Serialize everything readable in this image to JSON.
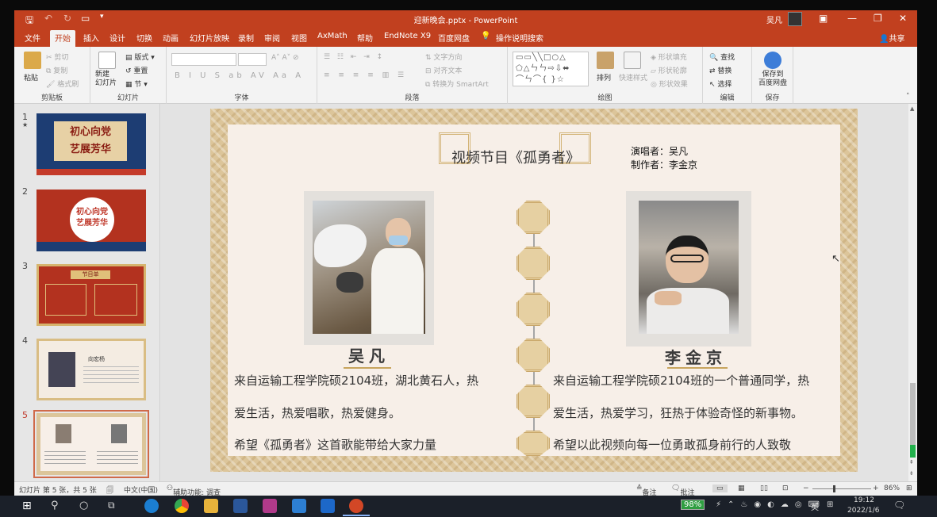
{
  "window": {
    "title": "迎新晚会.pptx - PowerPoint",
    "user": "吴凡"
  },
  "tabs": [
    "文件",
    "开始",
    "插入",
    "设计",
    "切换",
    "动画",
    "幻灯片放映",
    "录制",
    "审阅",
    "视图",
    "AxMath",
    "帮助",
    "EndNote X9",
    "百度网盘",
    "操作说明搜索",
    "共享"
  ],
  "ribbon": {
    "clipboard": {
      "label": "剪贴板",
      "paste": "粘贴",
      "cut": "剪切",
      "copy": "复制",
      "painter": "格式刷"
    },
    "slides": {
      "label": "幻灯片",
      "new_slide": "新建\n幻灯片",
      "layout": "版式",
      "reset": "重置",
      "section": "节"
    },
    "font": {
      "label": "字体"
    },
    "paragraph": {
      "label": "段落",
      "text_direction": "文字方向",
      "align_text": "对齐文本",
      "smartart": "转换为 SmartArt"
    },
    "drawing": {
      "label": "绘图",
      "arrange": "排列",
      "quick_styles": "快速样式",
      "fill": "形状填充",
      "outline": "形状轮廓",
      "effects": "形状效果"
    },
    "editing": {
      "label": "编辑",
      "find": "查找",
      "replace": "替换",
      "select": "选择"
    },
    "save": {
      "label": "保存",
      "save_baidu": "保存到\n百度网盘"
    }
  },
  "thumbnails": [
    {
      "num": "1",
      "star": "★",
      "text": "初心向党\n艺展芳华"
    },
    {
      "num": "2",
      "text": "初心向党\n艺展芳华"
    },
    {
      "num": "3",
      "text": "节目单"
    },
    {
      "num": "4",
      "text": "向宏杨"
    },
    {
      "num": "5",
      "text": ""
    }
  ],
  "slide": {
    "title": "视频节目《孤勇者》",
    "singer": "演唱者：吴凡",
    "producer": "制作者：李金京",
    "left": {
      "name": "吴凡",
      "lines": [
        "来自运输工程学院硕2104班，湖北黄石人，热",
        "爱生活，热爱唱歌，热爱健身。",
        "希望《孤勇者》这首歌能带给大家力量"
      ]
    },
    "right": {
      "name": "李金京",
      "lines": [
        "来自运输工程学院硕2104班的一个普通同学，热",
        "爱生活，热爱学习，狂热于体验奇怪的新事物。",
        "希望以此视频向每一位勇敢孤身前行的人致敬"
      ]
    }
  },
  "status": {
    "slide_of": "幻灯片 第 5 张，共 5 张",
    "lang": "中文(中国)",
    "access": "辅助功能: 调查",
    "notes": "备注",
    "comments": "批注",
    "zoom": "86%"
  },
  "taskbar": {
    "battery": "98%",
    "ime": "英",
    "time": "19:12",
    "date": "2022/1/6"
  }
}
